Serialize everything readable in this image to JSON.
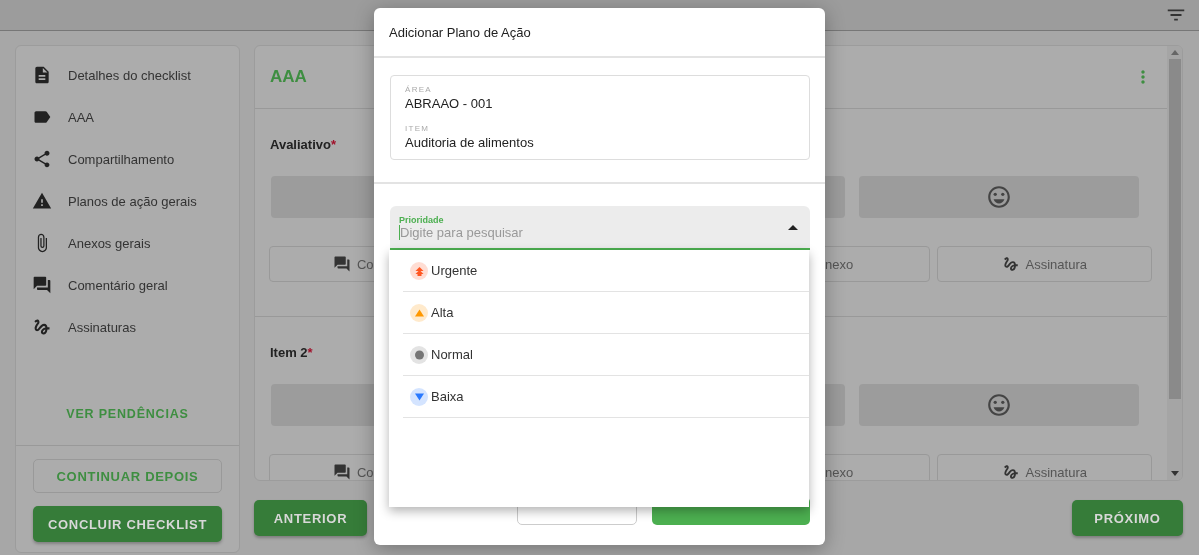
{
  "sidebar": {
    "items": [
      {
        "label": "Detalhes do checklist"
      },
      {
        "label": "AAA"
      },
      {
        "label": "Compartilhamento"
      },
      {
        "label": "Planos de ação gerais"
      },
      {
        "label": "Anexos gerais"
      },
      {
        "label": "Comentário geral"
      },
      {
        "label": "Assinaturas"
      }
    ],
    "pending_link": "VER PENDÊNCIAS",
    "buttons": [
      {
        "label": "CONTINUAR DEPOIS",
        "kind": "outlined"
      },
      {
        "label": "CONCLUIR CHECKLIST",
        "kind": "filled"
      }
    ]
  },
  "section": {
    "title": "AAA",
    "questions": [
      {
        "label": "Avaliativo",
        "mark": "*",
        "actions": [
          "Co",
          "nexo",
          "Assinatura"
        ]
      },
      {
        "label": "Item 2",
        "mark": "*",
        "actions": [
          "Co",
          "nexo",
          "Assinatura"
        ]
      }
    ]
  },
  "nav": {
    "previous": "ANTERIOR",
    "next": "PRÓXIMO"
  },
  "dialog": {
    "title": "Adicionar Plano de Ação",
    "area_label": "ÁREA",
    "area": "ABRAAO - 001",
    "item_label": "ITEM",
    "item": "Auditoria de alimentos",
    "priority": {
      "label": "Prioridade",
      "placeholder": "Digite para pesquisar",
      "expanded": true,
      "options": [
        {
          "label": "Urgente",
          "color": "#ff5722"
        },
        {
          "label": "Alta",
          "color": "#ff9800"
        },
        {
          "label": "Normal",
          "color": "#757575"
        },
        {
          "label": "Baixa",
          "color": "#2979ff"
        }
      ]
    }
  }
}
